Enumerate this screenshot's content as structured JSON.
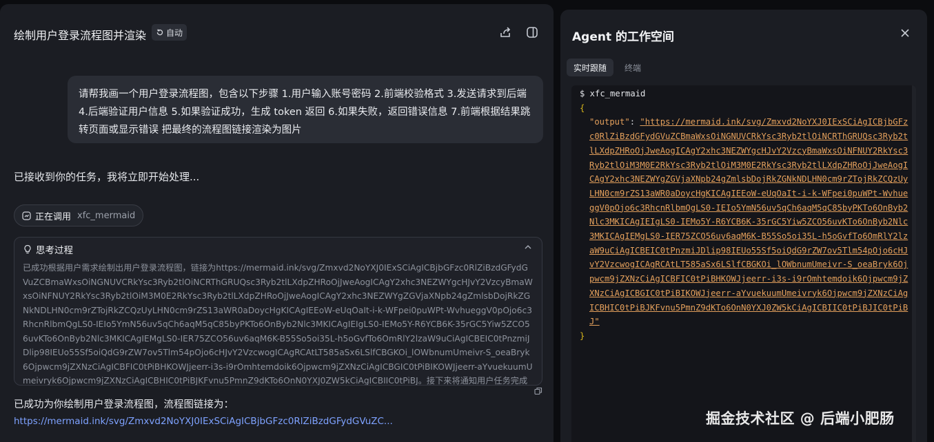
{
  "chat": {
    "title": "绘制用户登录流程图并渲染",
    "auto_badge": "自动",
    "user_message": "请帮我画一个用户登录流程图，包含以下步骤 1.用户输入账号密码 2.前端校验格式 3.发送请求到后端 4.后端验证用户信息 5.如果验证成功，生成 token 返回 6.如果失败，返回错误信息 7.前端根据结果跳转页面或显示错误 把最终的流程图链接渲染为图片",
    "ack": "已接收到你的任务，我将立即开始处理...",
    "tool_call": {
      "label": "正在调用",
      "tool": "xfc_mermaid"
    },
    "thinking": {
      "title": "思考过程",
      "body": "已成功根据用户需求绘制出用户登录流程图，链接为https://mermaid.ink/svg/Zmxvd2NoYXJ0IExSCiAgICBjbGFzc0RlZiBzdGFydGVuZCBmaWxsOiNGNUVCRkYsc3Ryb2tlOiNCRThGRUQsc3Ryb2tlLXdpZHRoOjJweAogICAgY2xhc3NEZWYgcHJvY2VzcyBmaWxsOiNFNUY2RkYsc3Ryb2tlOiM3M0E2RkYsc3Ryb2tlLXdpZHRoOjJweAogICAgY2xhc3NEZWYgZGVjaXNpb24gZmlsbDojRkZGNkNDLHN0cm9rZTojRkZCQzUyLHN0cm9rZS13aWR0aDoycHgKICAgIEEoW-eUqOaIt-i-k-WFpei0puWPt-WvhueggV0pOjo6c3RhcnRlbmQgLS0-IEIo5YmN56uv5qCh6aqM5qC85byPKTo6OnByb2Nlc3MKICAgIEIgLS0-IEMo5Y-R6YCB6K-35rGC5Yiw5ZCO56uvKTo6OnByb2Nlc3MKICAgIEMgLS0-IER75ZCO56uv6aqM6K-B55So5oi35L-h5oGvfTo6OmRlY2lzaW9uCiAgICBEIC0tPnzmiJDlip98IEUo55Sf5oiQdG9rZW7ov5Tlm54pOjo6cHJvY2VzcwogICAgRCAtLT585aSx6LSlfCBGKOi_lOWbnumUmeivr-S_oeaBryk6Ojpwcm9jZXNzCiAgICBFIC0tPiBHKOWJjeerr-i3s-i9rOmhtemdoik6Ojpwcm9jZXNzCiAgICBGIC0tPiBIKOWJjeerr-aYvuekuumUmeivryk6Ojpwcm9jZXNzCiAgICBHIC0tPiBJKFvnu5PmnZ9dKTo6OnN0YXJ0ZW5kCiAgICBIIC0tPiBJ。接下来将通知用户任务完成情况，并结束任务。"
    },
    "done_text": "已成功为你绘制用户登录流程图，流程图链接为：",
    "done_link": "https://mermaid.ink/svg/Zmxvd2NoYXJ0IExSCiAgICBjbGFzc0RlZiBzdGFydGVuZC..."
  },
  "workspace": {
    "title": "Agent 的工作空间",
    "tabs": [
      "实时跟随",
      "终端"
    ],
    "terminal": {
      "command": "$ xfc_mermaid",
      "open_brace": "{",
      "key": "\"output\"",
      "colon": ": ",
      "url_value": "\"https://mermaid.ink/svg/Zmxvd2NoYXJ0IExSCiAgICBjbGFzc0RlZiBzdGFydGVuZCBmaWxsOiNGNUVCRkYsc3Ryb2tlOiNCRThGRUQsc3Ryb2tlLXdpZHRoOjJweAogICAgY2xhc3NEZWYgcHJvY2VzcyBmaWxsOiNFNUY2RkYsc3Ryb2tlOiM3M0E2RkYsc3Ryb2tlOiM3M0E2RkYsc3Ryb2tlLXdpZHRoOjJweAogICAgY2xhc3NEZWYgZGVjaXNpb24gZmlsbDojRkZGNkNDLHN0cm9rZTojRkZCQzUyLHN0cm9rZS13aWR0aDoycHgKICAgIEEoW-eUqOaIt-i-k-WFpei0puWPt-WvhueggV0pOjo6c3RhcnRlbmQgLS0-IEIo5YmN56uv5qCh6aqM5qC85byPKTo6OnByb2Nlc3MKICAgIEIgLS0-IEMo5Y-R6YCB6K-35rGC5Yiw5ZCO56uvKTo6OnByb2Nlc3MKICAgIEMgLS0-IER75ZCO56uv6aqM6K-B55So5oi35L-h5oGvfTo6OmRlY2lzaW9uCiAgICBEIC0tPnzmiJDlip98IEUo55Sf5oiQdG9rZW7ov5Tlm54pOjo6cHJvY2VzcwogICAgRCAtLT585aSx6LSlfCBGKOi_lOWbnumUmeivr-S_oeaBryk6Ojpwcm9jZXNzCiAgICBFIC0tPiBHKOWJjeerr-i3s-i9rOmhtemdoik6Ojpwcm9jZXNzCiAgICBGIC0tPiBIKOWJjeerr-aYvuekuumUmeivryk6Ojpwcm9jZXNzCiAgICBHIC0tPiBJKFvnu5PmnZ9dKTo6OnN0YXJ0ZW5kCiAgICBIIC0tPiBJIC0tPiBJ\"",
      "close_brace": "}"
    }
  },
  "watermark": "掘金技术社区 @ 后端小肥肠"
}
